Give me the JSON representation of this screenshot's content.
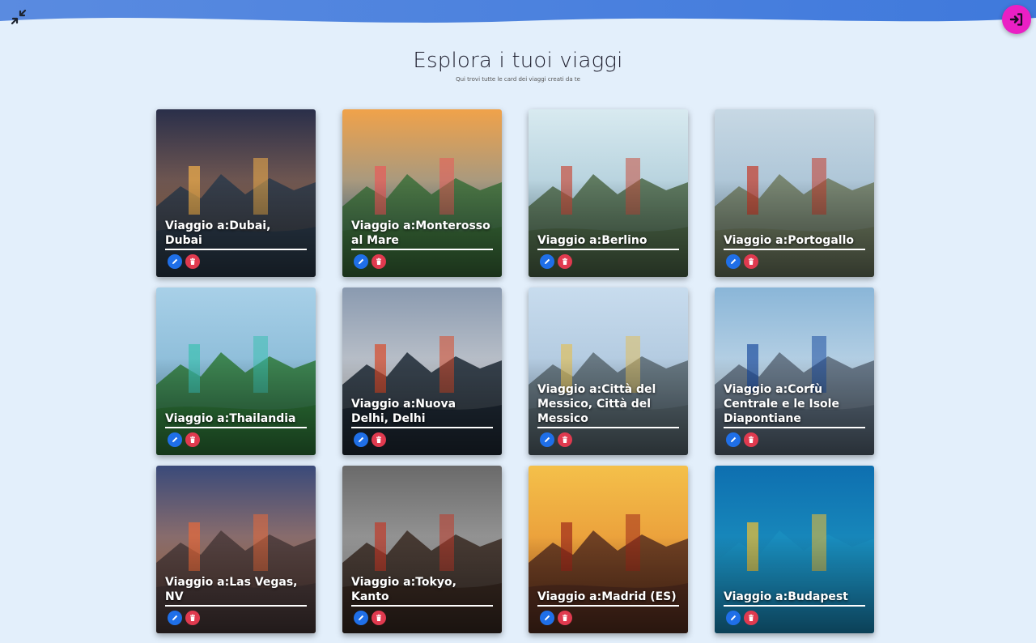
{
  "page": {
    "title": "Esplora i tuoi viaggi",
    "subtitle": "Qui trovi tutte le card dei viaggi creati da te"
  },
  "icons": {
    "collapse": "collapse-arrows-icon",
    "login": "login-arrow-icon",
    "edit": "pencil-icon",
    "delete": "trash-icon"
  },
  "colors": {
    "background": "#e3effb",
    "login_button": "#ea1fc4",
    "edit_button": "#1f6fe8",
    "delete_button": "#e03a4f"
  },
  "trips": [
    {
      "label": "Viaggio a:Dubai, Dubai",
      "sky": [
        "#2a2f4a",
        "#c98a5a"
      ],
      "ground": "#2b3a4a",
      "accent": "#f4b04a"
    },
    {
      "label": "Viaggio a:Monterosso al Mare",
      "sky": [
        "#f0a24a",
        "#4a8ec4"
      ],
      "ground": "#3b6e3a",
      "accent": "#e85a5a"
    },
    {
      "label": "Viaggio a:Berlino",
      "sky": [
        "#d8eaf0",
        "#8fb6c8"
      ],
      "ground": "#4f6a4a",
      "accent": "#c85040"
    },
    {
      "label": "Viaggio a:Portogallo",
      "sky": [
        "#c7d8e4",
        "#8fb0c8"
      ],
      "ground": "#6e7a60",
      "accent": "#c43a2a"
    },
    {
      "label": "Viaggio a:Thailandia",
      "sky": [
        "#a8d0e8",
        "#6fa8c8"
      ],
      "ground": "#2f7a3a",
      "accent": "#3cc0b0"
    },
    {
      "label": "Viaggio a:Nuova Delhi, Delhi",
      "sky": [
        "#8a9ab0",
        "#f2ede6"
      ],
      "ground": "#1f2a36",
      "accent": "#d84a2a"
    },
    {
      "label": "Viaggio a:Città del Messico, Città del Messico",
      "sky": [
        "#c8dcee",
        "#9ab6d0"
      ],
      "ground": "#5a6a72",
      "accent": "#e0c060"
    },
    {
      "label": "Viaggio a:Corfù Centrale e le Isole Diapontiane",
      "sky": [
        "#8ab6d8",
        "#e8eef2"
      ],
      "ground": "#5a6a7a",
      "accent": "#1e4fa0"
    },
    {
      "label": "Viaggio a:Las Vegas, NV",
      "sky": [
        "#3a4a7a",
        "#f29a5a"
      ],
      "ground": "#4a3a3a",
      "accent": "#e86a3a"
    },
    {
      "label": "Viaggio a:Tokyo, Kanto",
      "sky": [
        "#6a6a6a",
        "#c8c8c8"
      ],
      "ground": "#3a2a22",
      "accent": "#c03a2a"
    },
    {
      "label": "Viaggio a:Madrid (ES)",
      "sky": [
        "#f4c04a",
        "#e07a2a"
      ],
      "ground": "#5a3020",
      "accent": "#a02a1a"
    },
    {
      "label": "Viaggio a:Budapest",
      "sky": [
        "#0e6fb0",
        "#23a6c8"
      ],
      "ground": "#1a8ec0",
      "accent": "#f4c030"
    }
  ]
}
